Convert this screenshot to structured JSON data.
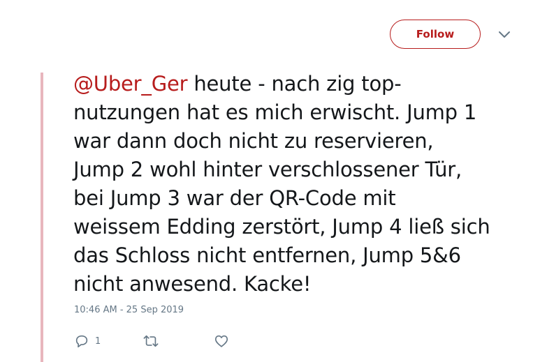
{
  "header": {
    "follow_label": "Follow",
    "caret_icon": "chevron-down-icon"
  },
  "tweet": {
    "mention": "@Uber_Ger",
    "line1_rest": " heute - nach zig top-",
    "lines": [
      "nutzungen hat es mich erwischt. Jump 1",
      "war dann doch nicht zu reservieren,",
      "Jump 2 wohl hinter verschlossener Tür,",
      "bei Jump 3 war der QR-Code mit",
      "weissem Edding zerstört, Jump 4 ließ sich",
      "das Schloss nicht entfernen, Jump 5&6",
      "nicht anwesend. Kacke!"
    ],
    "timestamp": "10:46 AM - 25 Sep 2019"
  },
  "actions": {
    "reply_count": "1",
    "reply_icon": "reply-icon",
    "retweet_icon": "retweet-icon",
    "like_icon": "heart-icon"
  },
  "colors": {
    "accent": "#b71c1c",
    "left_rule": "#e8b6bd",
    "meta": "#657786",
    "text": "#14171a"
  }
}
